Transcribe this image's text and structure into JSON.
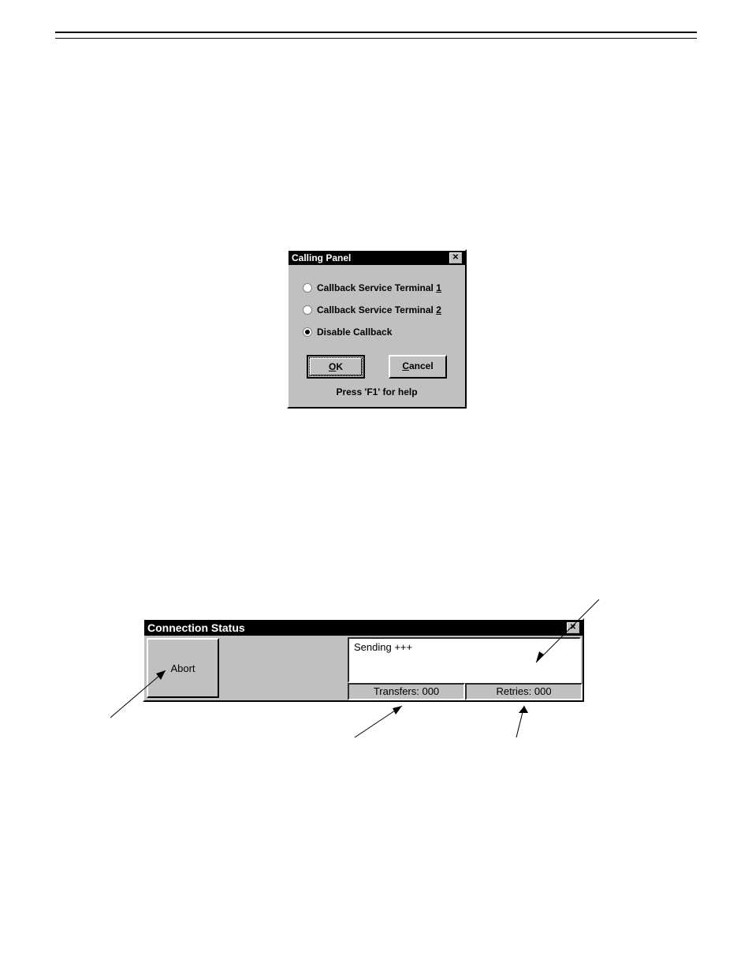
{
  "dialog1": {
    "title": "Calling Panel",
    "radios": [
      {
        "label_prefix": "Callback Service Terminal ",
        "label_accel": "1",
        "selected": false
      },
      {
        "label_prefix": "Callback Service Terminal ",
        "label_accel": "2",
        "selected": false
      },
      {
        "label_prefix": "Disable Callback",
        "label_accel": "",
        "selected": true
      }
    ],
    "ok": "OK",
    "ok_accel": "O",
    "ok_rest": "K",
    "cancel": "Cancel",
    "cancel_accel": "C",
    "cancel_rest": "ancel",
    "hint": "Press 'F1' for help"
  },
  "dialog2": {
    "title": "Connection Status",
    "abort": "Abort",
    "message": "Sending +++",
    "transfers_label": "Transfers: 000",
    "retries_label": "Retries: 000"
  }
}
